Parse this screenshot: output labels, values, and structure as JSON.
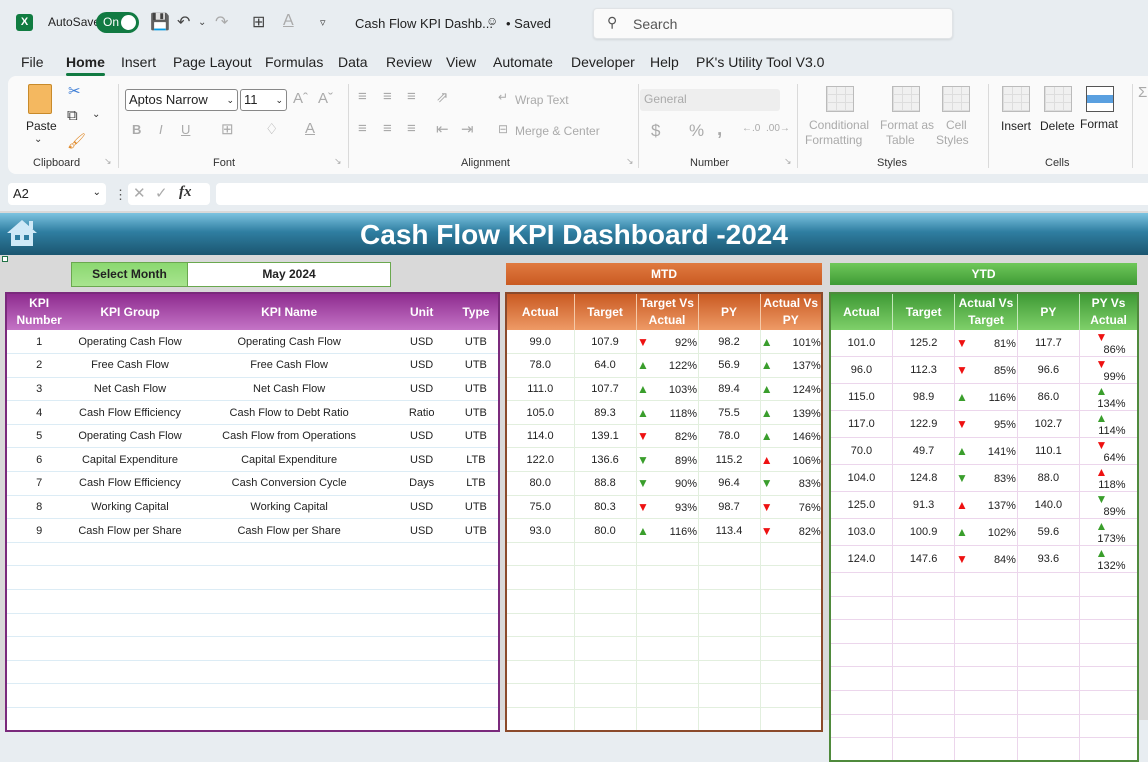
{
  "titlebar": {
    "autosave_label": "AutoSave",
    "autosave_state": "On",
    "doc_title": "Cash Flow KPI Dashb...",
    "saved_label": "• Saved",
    "search_placeholder": "Search"
  },
  "menu": [
    "File",
    "Home",
    "Insert",
    "Page Layout",
    "Formulas",
    "Data",
    "Review",
    "View",
    "Automate",
    "Developer",
    "Help",
    "PK's Utility Tool V3.0"
  ],
  "menu_active": "Home",
  "ribbon": {
    "clipboard": {
      "paste": "Paste",
      "group": "Clipboard"
    },
    "font": {
      "name": "Aptos Narrow",
      "size": "11",
      "group": "Font"
    },
    "alignment": {
      "wrap": "Wrap Text",
      "merge": "Merge & Center",
      "group": "Alignment"
    },
    "number": {
      "format": "General",
      "group": "Number"
    },
    "styles": {
      "cond1": "Conditional",
      "cond2": "Formatting",
      "fmt1": "Format as",
      "fmt2": "Table",
      "cell1": "Cell",
      "cell2": "Styles",
      "group": "Styles"
    },
    "cells": {
      "insert": "Insert",
      "delete": "Delete",
      "format": "Format",
      "group": "Cells"
    }
  },
  "formula_bar": {
    "name_box": "A2",
    "fx": "fx",
    "value": ""
  },
  "dashboard": {
    "title": "Cash Flow KPI Dashboard -2024",
    "select_month_label": "Select Month",
    "select_month_value": "May 2024",
    "mtd_label": "MTD",
    "ytd_label": "YTD",
    "kpi_headers": [
      "KPI Number",
      "KPI Group",
      "KPI Name",
      "Unit",
      "Type"
    ],
    "mtd_headers": [
      "Actual",
      "Target",
      "Target Vs Actual",
      "PY",
      "Actual Vs PY"
    ],
    "ytd_headers": [
      "Actual",
      "Target",
      "Actual Vs Target",
      "PY",
      "PY Vs Actual"
    ],
    "colors": {
      "up_good": "#3a9e2c",
      "down_bad": "#ee1111",
      "mtd": "#c95a22",
      "ytd": "#3f9a35",
      "kpi": "#8e2c8f",
      "banner": "#2f7ea1"
    },
    "rows": [
      {
        "no": "1",
        "group": "Operating Cash Flow",
        "name": "Operating Cash Flow",
        "unit": "USD",
        "type": "UTB",
        "mtd": {
          "actual": "99.0",
          "target": "107.9",
          "tva": {
            "dir": "down",
            "color": "red",
            "pct": "92%"
          },
          "py": "98.2",
          "avp": {
            "dir": "up",
            "color": "green",
            "pct": "101%"
          }
        },
        "ytd": {
          "actual": "101.0",
          "target": "125.2",
          "avt": {
            "dir": "down",
            "color": "red",
            "pct": "81%"
          },
          "py": "117.7",
          "pva": {
            "dir": "down",
            "color": "red",
            "pct": "86%"
          }
        }
      },
      {
        "no": "2",
        "group": "Free Cash Flow",
        "name": "Free Cash Flow",
        "unit": "USD",
        "type": "UTB",
        "mtd": {
          "actual": "78.0",
          "target": "64.0",
          "tva": {
            "dir": "up",
            "color": "green",
            "pct": "122%"
          },
          "py": "56.9",
          "avp": {
            "dir": "up",
            "color": "green",
            "pct": "137%"
          }
        },
        "ytd": {
          "actual": "96.0",
          "target": "112.3",
          "avt": {
            "dir": "down",
            "color": "red",
            "pct": "85%"
          },
          "py": "96.6",
          "pva": {
            "dir": "down",
            "color": "red",
            "pct": "99%"
          }
        }
      },
      {
        "no": "3",
        "group": "Net Cash Flow",
        "name": "Net Cash Flow",
        "unit": "USD",
        "type": "UTB",
        "mtd": {
          "actual": "111.0",
          "target": "107.7",
          "tva": {
            "dir": "up",
            "color": "green",
            "pct": "103%"
          },
          "py": "89.4",
          "avp": {
            "dir": "up",
            "color": "green",
            "pct": "124%"
          }
        },
        "ytd": {
          "actual": "115.0",
          "target": "98.9",
          "avt": {
            "dir": "up",
            "color": "green",
            "pct": "116%"
          },
          "py": "86.0",
          "pva": {
            "dir": "up",
            "color": "green",
            "pct": "134%"
          }
        }
      },
      {
        "no": "4",
        "group": "Cash Flow Efficiency",
        "name": "Cash Flow to Debt Ratio",
        "unit": "Ratio",
        "type": "UTB",
        "mtd": {
          "actual": "105.0",
          "target": "89.3",
          "tva": {
            "dir": "up",
            "color": "green",
            "pct": "118%"
          },
          "py": "75.5",
          "avp": {
            "dir": "up",
            "color": "green",
            "pct": "139%"
          }
        },
        "ytd": {
          "actual": "117.0",
          "target": "122.9",
          "avt": {
            "dir": "down",
            "color": "red",
            "pct": "95%"
          },
          "py": "102.7",
          "pva": {
            "dir": "up",
            "color": "green",
            "pct": "114%"
          }
        }
      },
      {
        "no": "5",
        "group": "Operating Cash Flow",
        "name": "Cash Flow from Operations",
        "unit": "USD",
        "type": "UTB",
        "mtd": {
          "actual": "114.0",
          "target": "139.1",
          "tva": {
            "dir": "down",
            "color": "red",
            "pct": "82%"
          },
          "py": "78.0",
          "avp": {
            "dir": "up",
            "color": "green",
            "pct": "146%"
          }
        },
        "ytd": {
          "actual": "70.0",
          "target": "49.7",
          "avt": {
            "dir": "up",
            "color": "green",
            "pct": "141%"
          },
          "py": "110.1",
          "pva": {
            "dir": "down",
            "color": "red",
            "pct": "64%"
          }
        }
      },
      {
        "no": "6",
        "group": "Capital Expenditure",
        "name": "Capital Expenditure",
        "unit": "USD",
        "type": "LTB",
        "mtd": {
          "actual": "122.0",
          "target": "136.6",
          "tva": {
            "dir": "down",
            "color": "green",
            "pct": "89%"
          },
          "py": "115.2",
          "avp": {
            "dir": "up",
            "color": "red",
            "pct": "106%"
          }
        },
        "ytd": {
          "actual": "104.0",
          "target": "124.8",
          "avt": {
            "dir": "down",
            "color": "green",
            "pct": "83%"
          },
          "py": "88.0",
          "pva": {
            "dir": "up",
            "color": "red",
            "pct": "118%"
          }
        }
      },
      {
        "no": "7",
        "group": "Cash Flow Efficiency",
        "name": "Cash Conversion Cycle",
        "unit": "Days",
        "type": "LTB",
        "mtd": {
          "actual": "80.0",
          "target": "88.8",
          "tva": {
            "dir": "down",
            "color": "green",
            "pct": "90%"
          },
          "py": "96.4",
          "avp": {
            "dir": "down",
            "color": "green",
            "pct": "83%"
          }
        },
        "ytd": {
          "actual": "125.0",
          "target": "91.3",
          "avt": {
            "dir": "up",
            "color": "red",
            "pct": "137%"
          },
          "py": "140.0",
          "pva": {
            "dir": "down",
            "color": "green",
            "pct": "89%"
          }
        }
      },
      {
        "no": "8",
        "group": "Working Capital",
        "name": "Working Capital",
        "unit": "USD",
        "type": "UTB",
        "mtd": {
          "actual": "75.0",
          "target": "80.3",
          "tva": {
            "dir": "down",
            "color": "red",
            "pct": "93%"
          },
          "py": "98.7",
          "avp": {
            "dir": "down",
            "color": "red",
            "pct": "76%"
          }
        },
        "ytd": {
          "actual": "103.0",
          "target": "100.9",
          "avt": {
            "dir": "up",
            "color": "green",
            "pct": "102%"
          },
          "py": "59.6",
          "pva": {
            "dir": "up",
            "color": "green",
            "pct": "173%"
          }
        }
      },
      {
        "no": "9",
        "group": "Cash Flow per Share",
        "name": "Cash Flow per Share",
        "unit": "USD",
        "type": "UTB",
        "mtd": {
          "actual": "93.0",
          "target": "80.0",
          "tva": {
            "dir": "up",
            "color": "green",
            "pct": "116%"
          },
          "py": "113.4",
          "avp": {
            "dir": "down",
            "color": "red",
            "pct": "82%"
          }
        },
        "ytd": {
          "actual": "124.0",
          "target": "147.6",
          "avt": {
            "dir": "down",
            "color": "red",
            "pct": "84%"
          },
          "py": "93.6",
          "pva": {
            "dir": "up",
            "color": "green",
            "pct": "132%"
          }
        }
      }
    ],
    "empty_rows": 8
  }
}
